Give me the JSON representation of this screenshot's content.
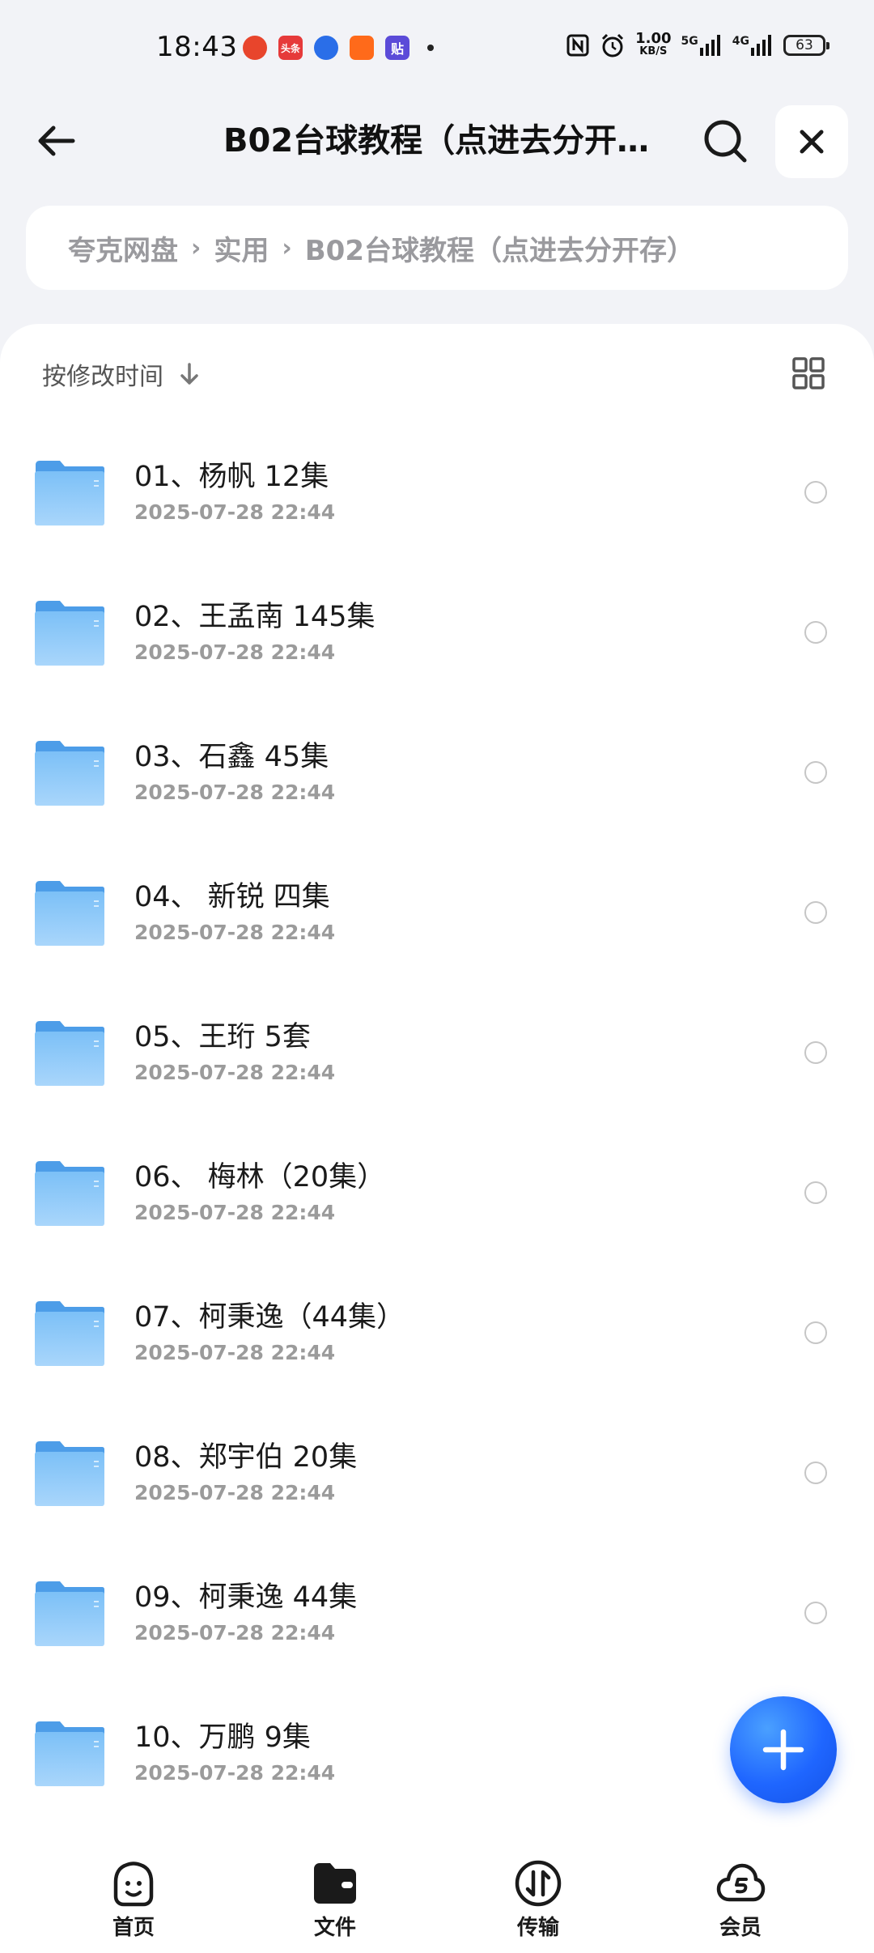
{
  "status_bar": {
    "time": "18:43",
    "net_speed_value": "1.00",
    "net_speed_unit": "KB/S",
    "signal_1": "5G",
    "signal_2": "4G",
    "battery": "63",
    "notifications": [
      {
        "icon": "app-red-icon",
        "color": "#e8452c",
        "label": ""
      },
      {
        "icon": "toutiao-icon",
        "color": "#e63a3a",
        "label": "头条"
      },
      {
        "icon": "app-blue-icon",
        "color": "#2a6ee8",
        "label": ""
      },
      {
        "icon": "app-orange-icon",
        "color": "#ff6a1a",
        "label": ""
      },
      {
        "icon": "tieba-icon",
        "color": "#5b4bd8",
        "label": "贴"
      }
    ]
  },
  "header": {
    "title": "B02台球教程（点进去分开存）"
  },
  "breadcrumb": {
    "items": [
      "夸克网盘",
      "实用",
      "B02台球教程（点进去分开存）"
    ],
    "separator": "›"
  },
  "toolbar": {
    "sort_label": "按修改时间"
  },
  "files": [
    {
      "name": "01、杨帆 12集",
      "date": "2025-07-28 22:44"
    },
    {
      "name": "02、王孟南 145集",
      "date": "2025-07-28 22:44"
    },
    {
      "name": "03、石鑫 45集",
      "date": "2025-07-28 22:44"
    },
    {
      "name": "04、 新锐 四集",
      "date": "2025-07-28 22:44"
    },
    {
      "name": "05、王珩 5套",
      "date": "2025-07-28 22:44"
    },
    {
      "name": "06、 梅林（20集）",
      "date": "2025-07-28 22:44"
    },
    {
      "name": "07、柯秉逸（44集）",
      "date": "2025-07-28 22:44"
    },
    {
      "name": "08、郑宇伯 20集",
      "date": "2025-07-28 22:44"
    },
    {
      "name": "09、柯秉逸 44集",
      "date": "2025-07-28 22:44"
    },
    {
      "name": "10、万鹏 9集",
      "date": "2025-07-28 22:44"
    }
  ],
  "bottom_nav": {
    "items": [
      {
        "label": "首页",
        "icon": "home-smile-icon"
      },
      {
        "label": "文件",
        "icon": "folder-filled-icon"
      },
      {
        "label": "传输",
        "icon": "transfer-icon"
      },
      {
        "label": "会员",
        "icon": "vip-cloud-icon"
      }
    ]
  },
  "colors": {
    "accent": "#1f66ff",
    "folder": "#5aa8ee",
    "background": "#f2f3f7"
  }
}
